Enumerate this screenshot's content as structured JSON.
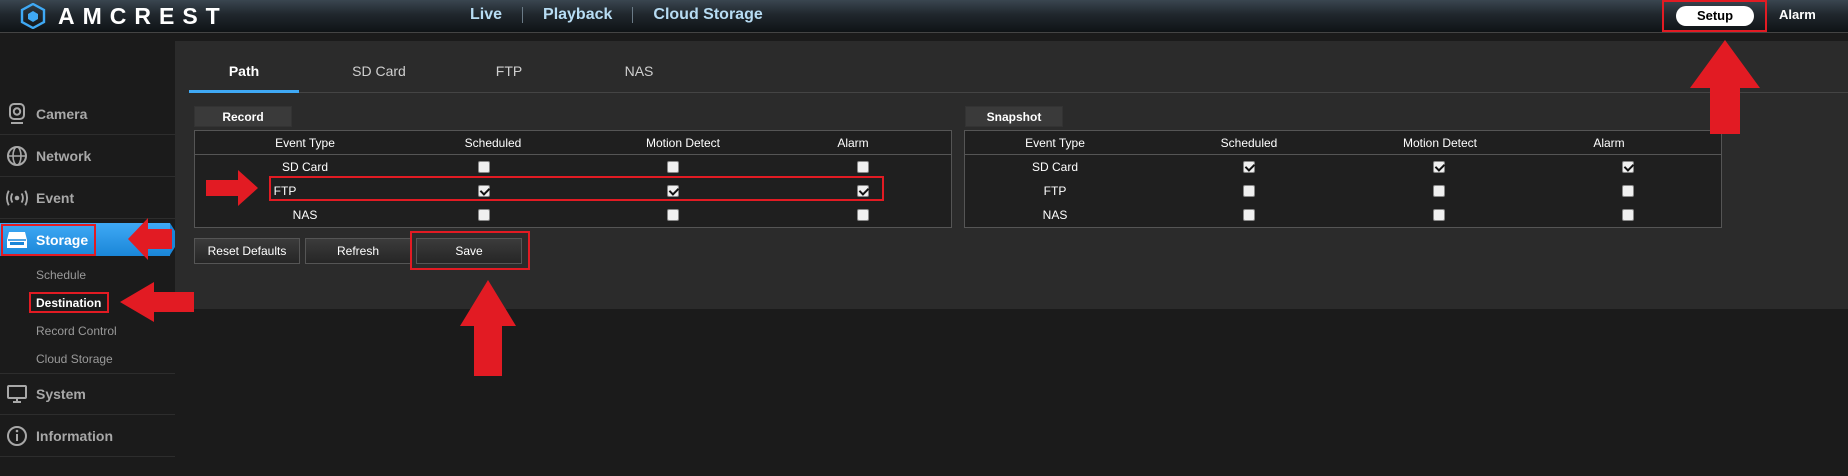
{
  "brand": {
    "name": "AMCREST"
  },
  "topnav": {
    "items": [
      "Live",
      "Playback",
      "Cloud Storage"
    ],
    "setup_label": "Setup",
    "alarm_label": "Alarm"
  },
  "sidebar": {
    "items": [
      {
        "label": "Camera",
        "icon": "camera-icon"
      },
      {
        "label": "Network",
        "icon": "globe-icon"
      },
      {
        "label": "Event",
        "icon": "broadcast-icon"
      },
      {
        "label": "Storage",
        "icon": "storage-icon"
      },
      {
        "label": "System",
        "icon": "monitor-icon"
      },
      {
        "label": "Information",
        "icon": "info-icon"
      }
    ],
    "storage_subitems": [
      "Schedule",
      "Destination",
      "Record Control",
      "Cloud Storage"
    ],
    "active_item": "Storage",
    "active_subitem": "Destination"
  },
  "tabs": [
    "Path",
    "SD Card",
    "FTP",
    "NAS"
  ],
  "active_tab": "Path",
  "record": {
    "title": "Record",
    "headers": [
      "Event Type",
      "Scheduled",
      "Motion Detect",
      "Alarm"
    ],
    "rows": [
      {
        "event": "SD Card",
        "scheduled": false,
        "motion": false,
        "alarm": false
      },
      {
        "event": "FTP",
        "scheduled": true,
        "motion": true,
        "alarm": true
      },
      {
        "event": "NAS",
        "scheduled": false,
        "motion": false,
        "alarm": false
      }
    ]
  },
  "snapshot": {
    "title": "Snapshot",
    "headers": [
      "Event Type",
      "Scheduled",
      "Motion Detect",
      "Alarm"
    ],
    "rows": [
      {
        "event": "SD Card",
        "scheduled": true,
        "motion": true,
        "alarm": true
      },
      {
        "event": "FTP",
        "scheduled": false,
        "motion": false,
        "alarm": false
      },
      {
        "event": "NAS",
        "scheduled": false,
        "motion": false,
        "alarm": false
      }
    ]
  },
  "buttons": {
    "reset": "Reset Defaults",
    "refresh": "Refresh",
    "save": "Save"
  },
  "colors": {
    "accent": "#3fa9f5",
    "annotation_red": "#e21b23"
  }
}
